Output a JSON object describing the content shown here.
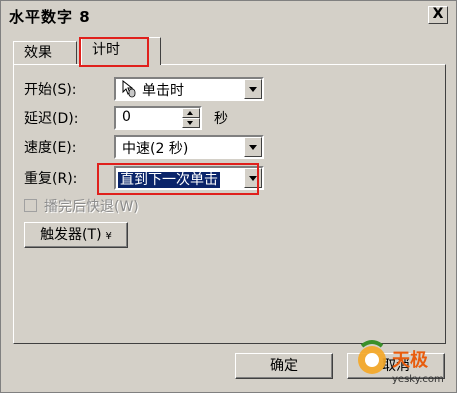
{
  "window": {
    "title": "水平数字 8",
    "close_symbol": "X"
  },
  "tabs": [
    {
      "label": "效果",
      "active": false
    },
    {
      "label": "计时",
      "active": true
    }
  ],
  "fields": {
    "start": {
      "label": "开始(S):",
      "value": "单击时"
    },
    "delay": {
      "label": "延迟(D):",
      "value": "0",
      "unit": "秒"
    },
    "speed": {
      "label": "速度(E):",
      "value": "中速(2 秒)"
    },
    "repeat": {
      "label": "重复(R):",
      "value": "直到下一次单击"
    }
  },
  "rewind": {
    "label": "播完后快退(W)",
    "checked": false,
    "enabled": false
  },
  "triggers": {
    "label": "触发器(T)",
    "arrow": "¥"
  },
  "buttons": {
    "ok": "确定",
    "cancel": "取消"
  },
  "watermark": {
    "text": "天极",
    "domain": "yesky.com"
  },
  "colors": {
    "highlight_red": "#e0201c",
    "selection": "#0a246a",
    "dialog_bg": "#d4d0c8"
  }
}
